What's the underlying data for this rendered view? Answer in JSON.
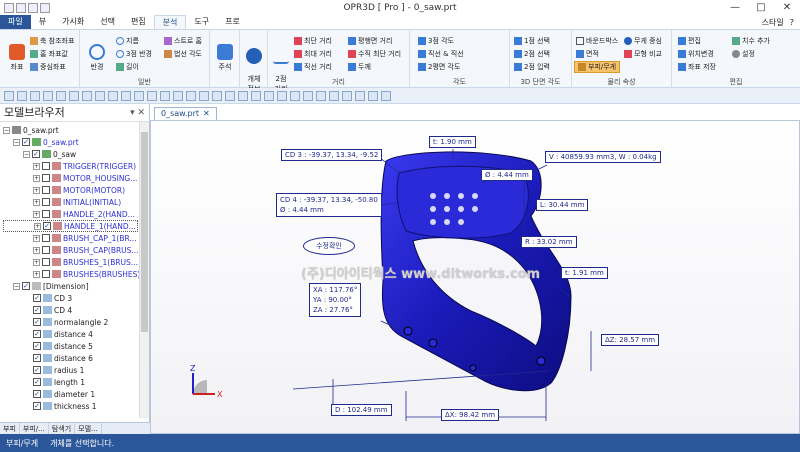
{
  "window": {
    "title": "OPR3D [ Pro ] - 0_saw.prt",
    "min": "—",
    "max": "□",
    "close": "✕"
  },
  "ribbon_tabs": [
    {
      "label": "파일"
    },
    {
      "label": "뷰"
    },
    {
      "label": "가시화"
    },
    {
      "label": "선택"
    },
    {
      "label": "편집"
    },
    {
      "label": "분석"
    },
    {
      "label": "도구"
    },
    {
      "label": "프로"
    }
  ],
  "ribbon_right": {
    "style": "스타일",
    "help": "?"
  },
  "ribbon": {
    "coord": {
      "big": "좌표",
      "b1": "축 참조좌표",
      "b2": "홈 좌표값",
      "b3": "중심좌표"
    },
    "general": {
      "radius": "반경",
      "b1": "지름",
      "b2": "3점 반경",
      "b3": "길이",
      "b4": "스트로 홈",
      "b5": "법선 각도",
      "label": "일반"
    },
    "note": {
      "big": "주석"
    },
    "objinfo": {
      "big": "개체\n정보"
    },
    "distance": {
      "big": "2점\n거리",
      "b1": "최단 거리",
      "b2": "최대 거리",
      "b3": "직선 거리",
      "b4": "평행면 거리",
      "b5": "수직 최단 거리",
      "b6": "두께",
      "label": "거리"
    },
    "angle": {
      "b1": "3점 각도",
      "b2": "직선 & 직선",
      "b3": "2평면 각도",
      "label": "각도"
    },
    "section": {
      "b1": "1점 선택",
      "b2": "2점 선택",
      "b3": "2점 입력",
      "label": "3D 단면 각도"
    },
    "physical": {
      "b1": "바운드박스",
      "b2": "무게 중심",
      "b3": "면적",
      "b4": "모형 비교",
      "b5": "부피/무게",
      "label": "물리 속성"
    },
    "edit": {
      "b1": "편집",
      "b2": "위치변경",
      "b3": "좌표 저장",
      "b4": "치수 추가",
      "b5": "설정",
      "label": "편집"
    }
  },
  "panel": {
    "title": "모델브라우저",
    "pin": "▾ ✕",
    "tree": [
      {
        "label": "0_saw.prt",
        "blue": false
      },
      {
        "label": "0_saw.prt",
        "blue": true
      },
      {
        "label": "0_saw",
        "blue": false
      },
      {
        "label": "TRIGGER(TRIGGER)",
        "blue": true
      },
      {
        "label": "MOTOR_HOUSING...",
        "blue": true
      },
      {
        "label": "MOTOR(MOTOR)",
        "blue": true
      },
      {
        "label": "INITIAL(INITIAL)",
        "blue": true
      },
      {
        "label": "HANDLE_2(HAND...",
        "blue": true
      },
      {
        "label": "HANDLE_1(HAND...",
        "blue": true
      },
      {
        "label": "BRUSH_CAP_1(BR...",
        "blue": true
      },
      {
        "label": "BRUSH_CAP(BRUS...",
        "blue": true
      },
      {
        "label": "BRUSHES_1(BRUS...",
        "blue": true
      },
      {
        "label": "BRUSHES(BRUSHES)",
        "blue": true
      },
      {
        "label": "[Dimension]",
        "blue": false
      },
      {
        "label": "CD 3",
        "blue": false
      },
      {
        "label": "CD 4",
        "blue": false
      },
      {
        "label": "normalangle 2",
        "blue": false
      },
      {
        "label": "distance 4",
        "blue": false
      },
      {
        "label": "distance 5",
        "blue": false
      },
      {
        "label": "distance 6",
        "blue": false
      },
      {
        "label": "radius 1",
        "blue": false
      },
      {
        "label": "length 1",
        "blue": false
      },
      {
        "label": "diameter 1",
        "blue": false
      },
      {
        "label": "thickness 1",
        "blue": false
      }
    ],
    "tabs": [
      {
        "label": "부피"
      },
      {
        "label": "부피/..."
      },
      {
        "label": "탐색기"
      },
      {
        "label": "모델..."
      }
    ]
  },
  "doc_tab": {
    "label": "0_saw.prt",
    "close": "✕"
  },
  "annotations": {
    "t1": "t: 1.90 mm",
    "cd3": "CD 3 : -39.37, 13.34, -9.52",
    "vol": "V : 40859.93 mm3, W : 0.04kg",
    "dia": "Ø : 4.44 mm",
    "cd4_a": "CD 4 : -39.37, 13.34, -50.80",
    "cd4_b": "Ø : 4.44 mm",
    "len": "L: 30.44 mm",
    "rad": "R : 33.02 mm",
    "fix": "수정확인",
    "t2": "t: 1.91 mm",
    "xa": "XA : 117.76°",
    "ya": "YA : 90.00°",
    "za": "ZA : 27.76°",
    "dz": "ΔZ: 28.57 mm",
    "d": "D : 102.49 mm",
    "dx": "ΔX: 98.42 mm",
    "watermark": "(주)디아이티웍스 www.ditworks.com",
    "axis_z": "Z",
    "axis_x": "X"
  },
  "status": {
    "mode": "부피/무게",
    "message": "개체를 선택합니다."
  }
}
